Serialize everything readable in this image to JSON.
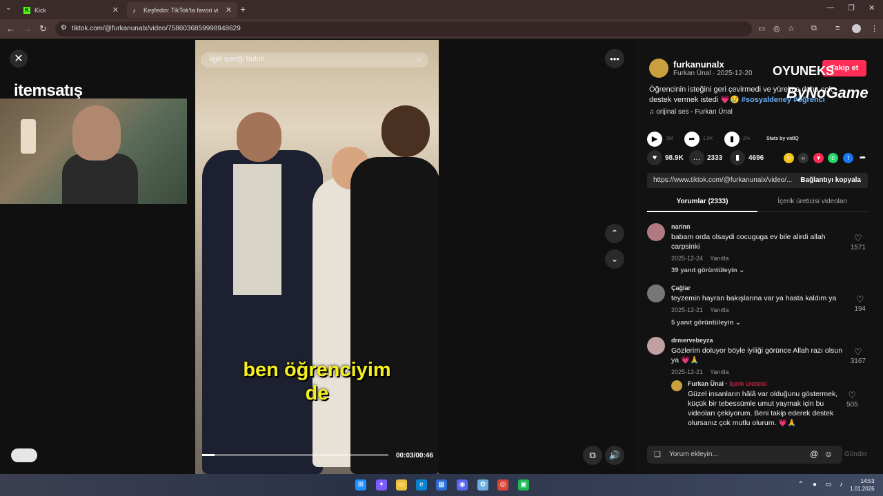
{
  "browser": {
    "tabs": [
      {
        "label": "Kick",
        "icon": "kick-icon"
      },
      {
        "label": "Keşfedin: TikTok'ta favori vi",
        "icon": "tiktok-icon"
      }
    ],
    "url": "tiktok.com/@furkanunalx/video/7586036859998948629"
  },
  "stream_overlay": {
    "brand": "itemsatış"
  },
  "video": {
    "search_placeholder": "İlgili içeriği bulun",
    "caption_line1": "ben öğrenciyim",
    "caption_line2": "de",
    "timer": "00:03/00:46",
    "progress": 0.065
  },
  "creator": {
    "username": "furkanunalx",
    "subtitle": "Furkan Ünal · 2025-12-20",
    "follow_label": "Takip et",
    "description": "Öğrencinin isteğini geri çevirmedi ve yürekçe daha çok destek vermek istedi 💗😢",
    "tags": "#sosyaldeney #öğrenci",
    "music": "orijinal ses - Furkan Ünal",
    "overlay_logo": "OYUNEKS",
    "overlay_logo2": "ByNoGame"
  },
  "stats_row": {
    "play": "5M",
    "share": "1.9K",
    "percent": "2%",
    "vidiq": "Stats by vidIQ"
  },
  "engagement": {
    "likes": "98.9K",
    "comments": "2333",
    "saves": "4696"
  },
  "link": {
    "url": "https://www.tiktok.com/@furkanunalx/video/...",
    "copy_label": "Bağlantıyı kopyala"
  },
  "panel_tabs": {
    "comments": "Yorumlar (2333)",
    "creator_videos": "İçerik üreticisi videoları"
  },
  "comments": [
    {
      "user": "narinn",
      "text": "babam orda olsaydi cocuguga ev bile alirdi allah carpsinki",
      "date": "2025-12-24",
      "reply_label": "Yanıtla",
      "replies": "39 yanıt görüntüleyin",
      "likes": "1571"
    },
    {
      "user": "Çağlar",
      "text": "teyzemin hayran bakışlarına var ya hasta kaldım ya",
      "date": "2025-12-21",
      "reply_label": "Yanıtla",
      "replies": "5 yanıt görüntüleyin",
      "likes": "194"
    },
    {
      "user": "drmervebeyza",
      "text": "Gözlerim doluyor böyle iyiliği görünce Allah razı olsun ya 💗🙏",
      "date": "2025-12-21",
      "reply_label": "Yanıtla",
      "replies": "",
      "likes": "3167"
    }
  ],
  "creator_reply": {
    "user": "Furkan Ünal",
    "badge": "İçerik üreticisi",
    "text": "Güzel insanların hâlâ var olduğunu göstermek, küçük bir tebessümle umut yaymak için bu videoları çekiyorum. Beni takip ederek destek olursanız çok mutlu olurum. 💗🙏",
    "likes": "505"
  },
  "comment_input": {
    "placeholder": "Yorum ekleyin...",
    "send": "Gönder"
  },
  "clock": {
    "time": "14:53",
    "date": "1.01.2026"
  }
}
